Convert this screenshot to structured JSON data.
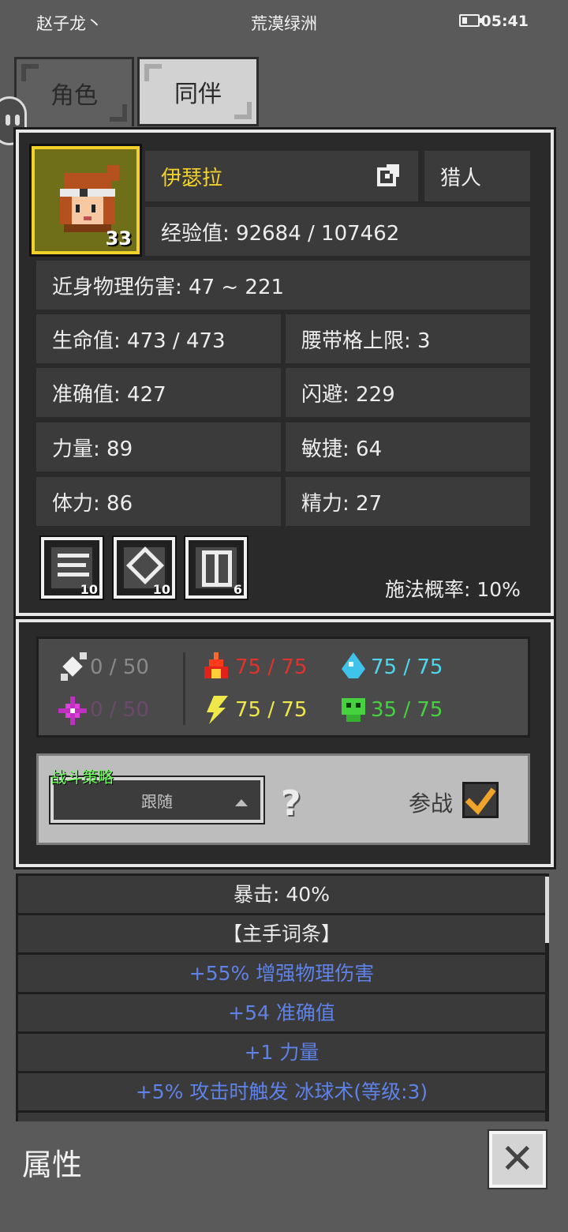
{
  "status_bar": {
    "user": "赵子龙丶",
    "location": "荒漠绿洲",
    "time": "05:41"
  },
  "tabs": [
    {
      "label": "角色"
    },
    {
      "label": "同伴"
    }
  ],
  "character": {
    "name": "伊瑟拉",
    "class": "猎人",
    "level": "33",
    "exp": "经验值: 92684 / 107462",
    "damage": "近身物理伤害: 47 ~ 221",
    "hp": "生命值: 473 / 473",
    "belt": "腰带格上限: 3",
    "accuracy": "准确值: 427",
    "dodge": "闪避: 229",
    "strength": "力量: 89",
    "agility": "敏捷: 64",
    "stamina": "体力: 86",
    "energy": "精力: 27",
    "cast_chance": "施法概率: 10%"
  },
  "skills": [
    {
      "icon": "skill-scroll-icon",
      "count": "10"
    },
    {
      "icon": "skill-shield-icon",
      "count": "10"
    },
    {
      "icon": "skill-book-icon",
      "count": "6"
    }
  ],
  "resistances": {
    "physical": "0 / 50",
    "magic": "0 / 50",
    "fire": "75 / 75",
    "lightning": "75 / 75",
    "cold": "75 / 75",
    "poison": "35 / 75"
  },
  "colors": {
    "fire": "#e0332b",
    "lightning": "#f0e84a",
    "cold": "#4fd6ee",
    "poison": "#45d23e",
    "physical": "#8a8a8a",
    "magic": "#6a4a6a",
    "name": "#f2d22a",
    "affix": "#5f82e8"
  },
  "strategy": {
    "label": "战斗策略",
    "selected": "跟随",
    "help": "?",
    "join_label": "参战",
    "join_checked": true
  },
  "item_list": [
    {
      "text": "暴击: 40%",
      "style": "white"
    },
    {
      "text": "【主手词条】",
      "style": "white"
    },
    {
      "text": "+55% 增强物理伤害",
      "style": "blue"
    },
    {
      "text": "+54 准确值",
      "style": "blue"
    },
    {
      "text": "+1 力量",
      "style": "blue"
    },
    {
      "text": "+5% 攻击时触发 冰球术(等级:3)",
      "style": "blue"
    }
  ],
  "footer": {
    "title": "属性",
    "close": "close-icon"
  }
}
